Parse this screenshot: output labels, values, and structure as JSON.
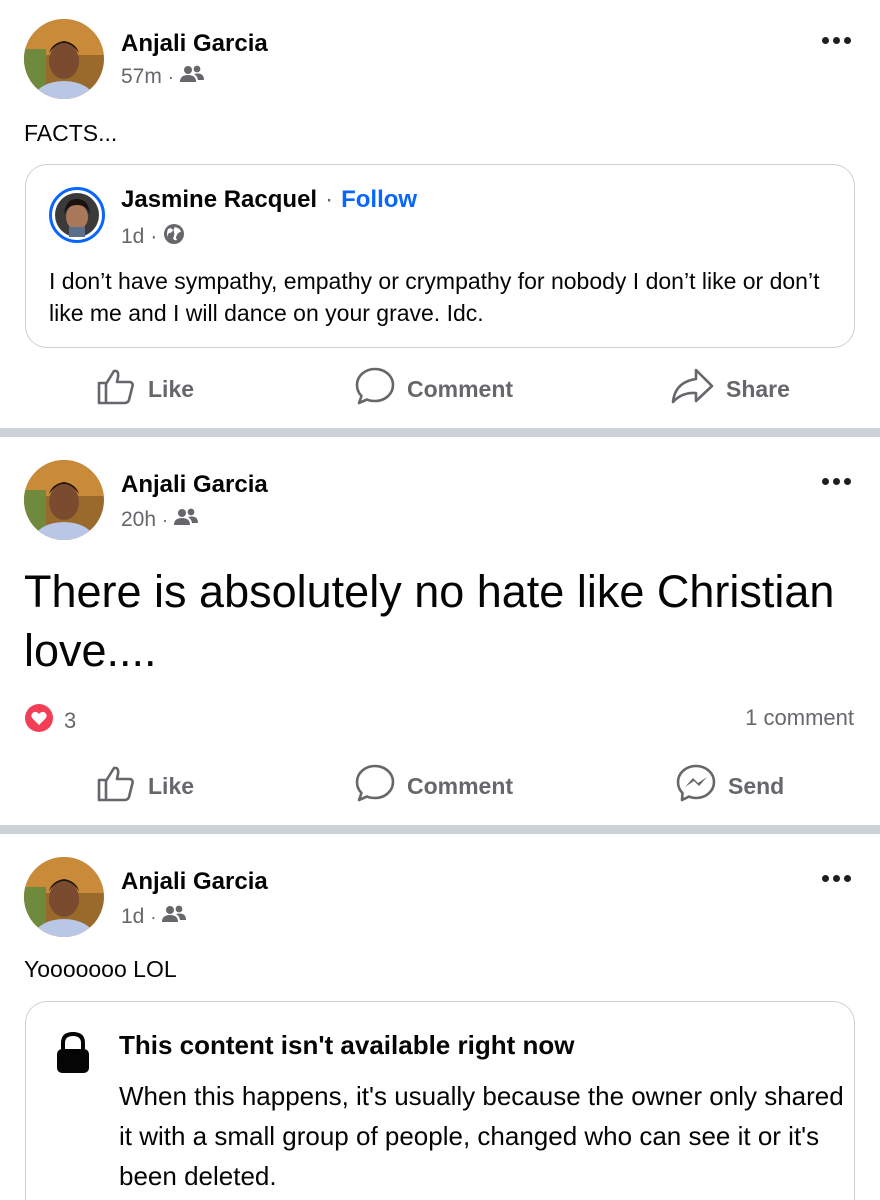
{
  "posts": [
    {
      "author": "Anjali Garcia",
      "time": "57m",
      "audience_icon": "friends-icon",
      "text": "FACTS...",
      "shared": {
        "author": "Jasmine Racquel",
        "separator": "·",
        "follow_label": "Follow",
        "time": "1d",
        "audience_icon": "globe-icon",
        "text": "I don’t have sympathy, empathy or crympathy for nobody I don’t like or don’t like me and I will dance on your grave. Idc."
      },
      "actions": {
        "like": "Like",
        "comment": "Comment",
        "share": "Share"
      }
    },
    {
      "author": "Anjali Garcia",
      "time": "20h",
      "audience_icon": "friends-icon",
      "text": "There is absolutely no hate like Christian love....",
      "reaction_count": "3",
      "comment_count": "1 comment",
      "actions": {
        "like": "Like",
        "comment": "Comment",
        "send": "Send"
      }
    },
    {
      "author": "Anjali Garcia",
      "time": "1d",
      "audience_icon": "friends-icon",
      "text": "Yooooooo LOL",
      "unavailable": {
        "title": "This content isn't available right now",
        "message": "When this happens, it's usually because the owner only shared it with a small group of people, changed who can see it or it's been deleted."
      }
    }
  ],
  "colors": {
    "accent": "#0866ff",
    "divider": "#cdd1d8",
    "secondary_text": "#65676b",
    "love": "#f33e58"
  }
}
